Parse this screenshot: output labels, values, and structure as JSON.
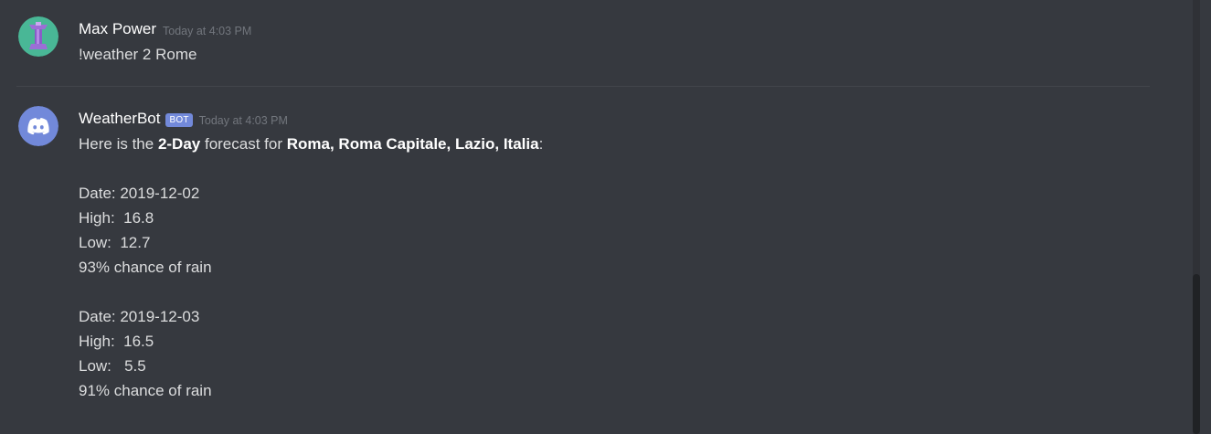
{
  "messages": [
    {
      "author": "Max Power",
      "timestamp": "Today at 4:03 PM",
      "avatar_icon": "tower-avatar-icon",
      "text": "!weather 2 Rome"
    },
    {
      "author": "WeatherBot",
      "badge": "BOT",
      "timestamp": "Today at 4:03 PM",
      "avatar_icon": "discord-logo-icon",
      "intro": {
        "prefix": "Here is the ",
        "bold1": "2-Day",
        "middle": " forecast for ",
        "bold2": "Roma, Roma Capitale, Lazio, Italia",
        "suffix": ":"
      },
      "forecast": [
        {
          "date_line": "Date: 2019-12-02",
          "high_line": "High:  16.8",
          "low_line": "Low:  12.7",
          "rain_line": "93% chance of rain"
        },
        {
          "date_line": "Date: 2019-12-03",
          "high_line": "High:  16.5",
          "low_line": "Low:   5.5",
          "rain_line": "91% chance of rain"
        }
      ]
    }
  ],
  "colors": {
    "background": "#36393f",
    "username": "#ffffff",
    "message_text": "#dcddde",
    "timestamp": "#72767d",
    "bot_badge": "#7289da",
    "user_avatar_bg": "#43b581",
    "bot_avatar_bg": "#7289da"
  }
}
